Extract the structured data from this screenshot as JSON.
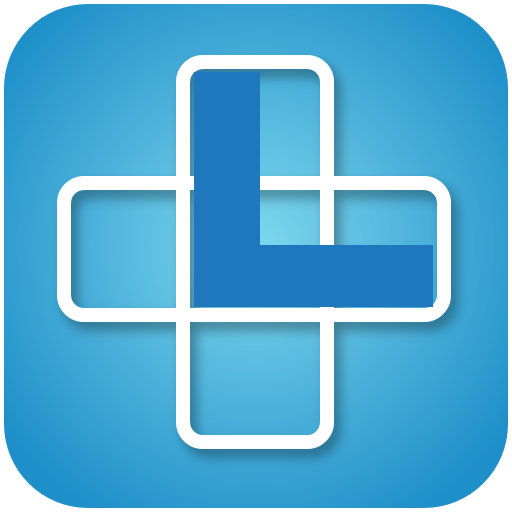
{
  "icon": {
    "name": "medical-cross-logo",
    "colors": {
      "background_center": "#7fd8ee",
      "background_edge": "#1e8fc9",
      "cross_outline": "#ffffff",
      "letter_fill": "#1f78bd"
    }
  }
}
